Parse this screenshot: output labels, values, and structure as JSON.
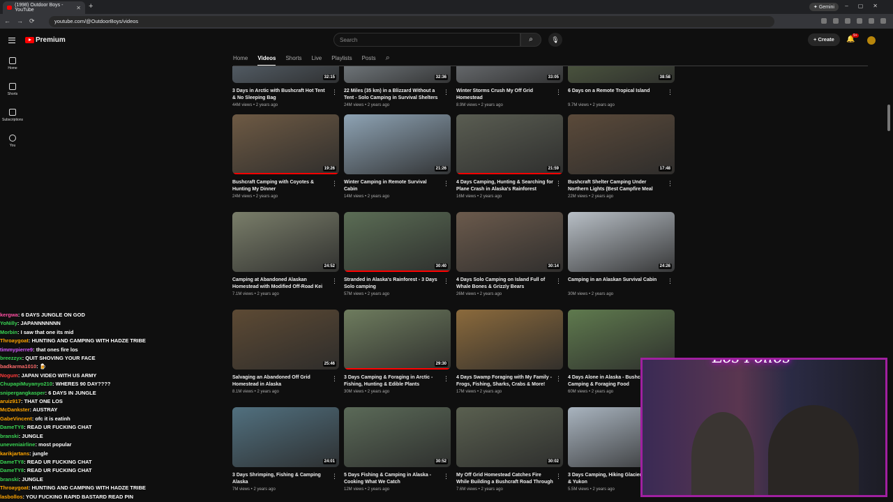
{
  "browser": {
    "tab_title": "(1998) Outdoor Boys - YouTube",
    "url": "youtube.com/@OutdoorBoys/videos",
    "gemini_label": "Gemini"
  },
  "header": {
    "logo_text": "Premium",
    "search_placeholder": "Search",
    "create_label": "Create",
    "notif_badge": "9+"
  },
  "sidebar": {
    "items": [
      {
        "label": "Home",
        "icon": "home-icon"
      },
      {
        "label": "Shorts",
        "icon": "shorts-icon"
      },
      {
        "label": "Subscriptions",
        "icon": "subscriptions-icon"
      },
      {
        "label": "You",
        "icon": "you-icon"
      }
    ]
  },
  "channel_tabs": [
    "Home",
    "Videos",
    "Shorts",
    "Live",
    "Playlists",
    "Posts"
  ],
  "videos": [
    {
      "title": "3 Days in Arctic with Bushcraft Hot Tent & No Sleeping Bag",
      "meta": "44M views • 2 years ago",
      "duration": "32:15",
      "thumb": "#6b7a88"
    },
    {
      "title": "22 Miles (35 km) in a Blizzard Without a Tent - Solo Camping in Survival Shelters",
      "meta": "24M views • 2 years ago",
      "duration": "32:36",
      "thumb": "#9aa4ab"
    },
    {
      "title": "Winter Storms Crush My Off Grid Homestead",
      "meta": "8.9M views • 2 years ago",
      "duration": "33:05",
      "thumb": "#8a8f94"
    },
    {
      "title": "6 Days on a Remote Tropical Island",
      "meta": "9.7M views • 2 years ago",
      "duration": "38:58",
      "thumb": "#5e6d4a"
    },
    {
      "title": "Bushcraft Camping with Coyotes & Hunting My Dinner",
      "meta": "24M views • 2 years ago",
      "duration": "19:26",
      "thumb": "#6e5a44"
    },
    {
      "title": "Winter Camping in Remote Survival Cabin",
      "meta": "14M views • 2 years ago",
      "duration": "21:26",
      "thumb": "#8ea3b4"
    },
    {
      "title": "4 Days Camping, Hunting & Searching for Plane Crash in Alaska's Rainforest",
      "meta": "16M views • 2 years ago",
      "duration": "21:59",
      "thumb": "#5a5d52"
    },
    {
      "title": "Bushcraft Shelter Camping Under Northern Lights (Best Campfire Meal Ever!)",
      "meta": "22M views • 2 years ago",
      "duration": "17:48",
      "thumb": "#5b4a3a"
    },
    {
      "title": "Camping at Abandoned Alaskan Homestead with Modified Off-Road Kei Truck",
      "meta": "7.1M views • 2 years ago",
      "duration": "24:52",
      "thumb": "#7a7e6a"
    },
    {
      "title": "Stranded in Alaska's Rainforest - 3 Days Solo camping",
      "meta": "57M views • 2 years ago",
      "duration": "30:40",
      "thumb": "#5b6d55"
    },
    {
      "title": "4 Days Solo Camping on Island Full of Whale Bones & Grizzly Bears",
      "meta": "26M views • 2 years ago",
      "duration": "30:14",
      "thumb": "#6b5a4c"
    },
    {
      "title": "Camping in an Alaskan Survival Cabin",
      "meta": "30M views • 2 years ago",
      "duration": "24:26",
      "thumb": "#b8bfc6"
    },
    {
      "title": "Salvaging an Abandoned Off Grid Homestead in Alaska",
      "meta": "8.1M views • 2 years ago",
      "duration": "25:46",
      "thumb": "#5d4a34"
    },
    {
      "title": "3 Days Camping & Foraging in Arctic - Fishing, Hunting & Edible Plants",
      "meta": "30M views • 2 years ago",
      "duration": "29:30",
      "thumb": "#6e7c5e"
    },
    {
      "title": "4 Days Swamp Foraging with My Family - Frogs, Fishing, Sharks, Crabs & More!",
      "meta": "17M views • 2 years ago",
      "duration": "",
      "thumb": "#8b6a3c"
    },
    {
      "title": "4 Days Alone in Alaska - Bushcraft Camping & Foraging Food",
      "meta": "60M views • 2 years ago",
      "duration": "",
      "thumb": "#5f7a4e"
    },
    {
      "title": "3 Days Shrimping, Fishing & Camping Alaska",
      "meta": "7M views • 2 years ago",
      "duration": "24:01",
      "thumb": "#51707f"
    },
    {
      "title": "5 Days Fishing & Camping in Alaska - Cooking What We Catch",
      "meta": "12M views • 2 years ago",
      "duration": "30:52",
      "thumb": "#5b6a58"
    },
    {
      "title": "My Off Grid Homestead Catches Fire While Building a Bushcraft Road Through Swamp",
      "meta": "7.6M views • 2 years ago",
      "duration": "30:02",
      "thumb": "#5a6050"
    },
    {
      "title": "3 Days Camping, Hiking Glaciers Alaska & Yukon",
      "meta": "5.5M views • 2 years ago",
      "duration": "",
      "thumb": "#a9b4bf"
    }
  ],
  "chat": [
    {
      "user": "kergwa",
      "color": "#ff4fa3",
      "msg": "6 DAYS JUNGLE ON GOD"
    },
    {
      "user": "YoNilly",
      "color": "#39d353",
      "msg": "JAPANNNNNNN"
    },
    {
      "user": "Morbin",
      "color": "#39d353",
      "msg": "I saw that one its mid"
    },
    {
      "user": "Throaygoat",
      "color": "#ffa500",
      "msg": "HUNTING AND CAMPING WITH HADZE TRIBE"
    },
    {
      "user": "timmypierre9",
      "color": "#d55bff",
      "msg": "that ones fire los"
    },
    {
      "user": "breezzyx",
      "color": "#39d353",
      "msg": "QUIT SHOVING YOUR FACE"
    },
    {
      "user": "badkarma1010",
      "color": "#ff6b6b",
      "msg": "🍺"
    },
    {
      "user": "Nogum",
      "color": "#ff3b3b",
      "msg": "JAPAN VIDEO WITH US ARMY"
    },
    {
      "user": "ChupapiMuyanyo210",
      "color": "#39d353",
      "msg": "WHERES 90 DAY????"
    },
    {
      "user": "snipergangkasper",
      "color": "#39d353",
      "msg": "6 DAYS IN JUNGLE"
    },
    {
      "user": "aruiz917",
      "color": "#ffa500",
      "msg": "THAT ONE LOS"
    },
    {
      "user": "McDankster",
      "color": "#ffa500",
      "msg": "AUSTRAY"
    },
    {
      "user": "GabeVincent",
      "color": "#ffa500",
      "msg": "ofc it is eatinh"
    },
    {
      "user": "DameTY8",
      "color": "#39d353",
      "msg": "READ UR FUCKING CHAT"
    },
    {
      "user": "branski",
      "color": "#39d353",
      "msg": "JUNGLE"
    },
    {
      "user": "uneveniairline",
      "color": "#39d353",
      "msg": "most popular"
    },
    {
      "user": "karikjartans",
      "color": "#ffa500",
      "msg": "jungle"
    },
    {
      "user": "DameTY8",
      "color": "#39d353",
      "msg": "READ UR FUCKING CHAT"
    },
    {
      "user": "DameTY8",
      "color": "#39d353",
      "msg": "READ UR FUCKING CHAT"
    },
    {
      "user": "branski",
      "color": "#39d353",
      "msg": "JUNGLE"
    },
    {
      "user": "Throaygoat",
      "color": "#ffa500",
      "msg": "HUNTING AND CAMPING WITH HADZE TRIBE"
    },
    {
      "user": "lasbollos",
      "color": "#ffa500",
      "msg": "YOU FUCKING RAPID BASTARD READ PIN"
    }
  ],
  "webcam": {
    "neon_sign": "Los Pollos"
  }
}
